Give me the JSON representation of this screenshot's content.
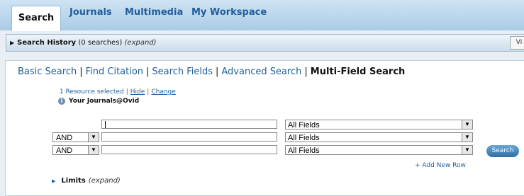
{
  "tabs": [
    "Search",
    "Journals",
    "Multimedia",
    "My Workspace"
  ],
  "history": {
    "title": "Search History",
    "count": "(0 searches)",
    "expand": "(expand)",
    "button": "Vi"
  },
  "modes": [
    "Basic Search",
    "Find Citation",
    "Search Fields",
    "Advanced Search",
    "Multi-Field Search"
  ],
  "resources": {
    "selected": "1 Resource selected",
    "hide": "Hide",
    "change": "Change",
    "journal": "Your Journals@Ovid"
  },
  "rows": [
    {
      "operator": "",
      "term": "",
      "field": "All Fields"
    },
    {
      "operator": "AND",
      "term": "",
      "field": "All Fields"
    },
    {
      "operator": "AND",
      "term": "",
      "field": "All Fields"
    }
  ],
  "search_button": "Search",
  "add_row": "+ Add New Row",
  "limits": {
    "label": "Limits",
    "expand": "(expand)"
  },
  "colors": {
    "link": "#1f5e9d",
    "tabbar": "#b9d5ec",
    "button": "#3c7db5"
  }
}
